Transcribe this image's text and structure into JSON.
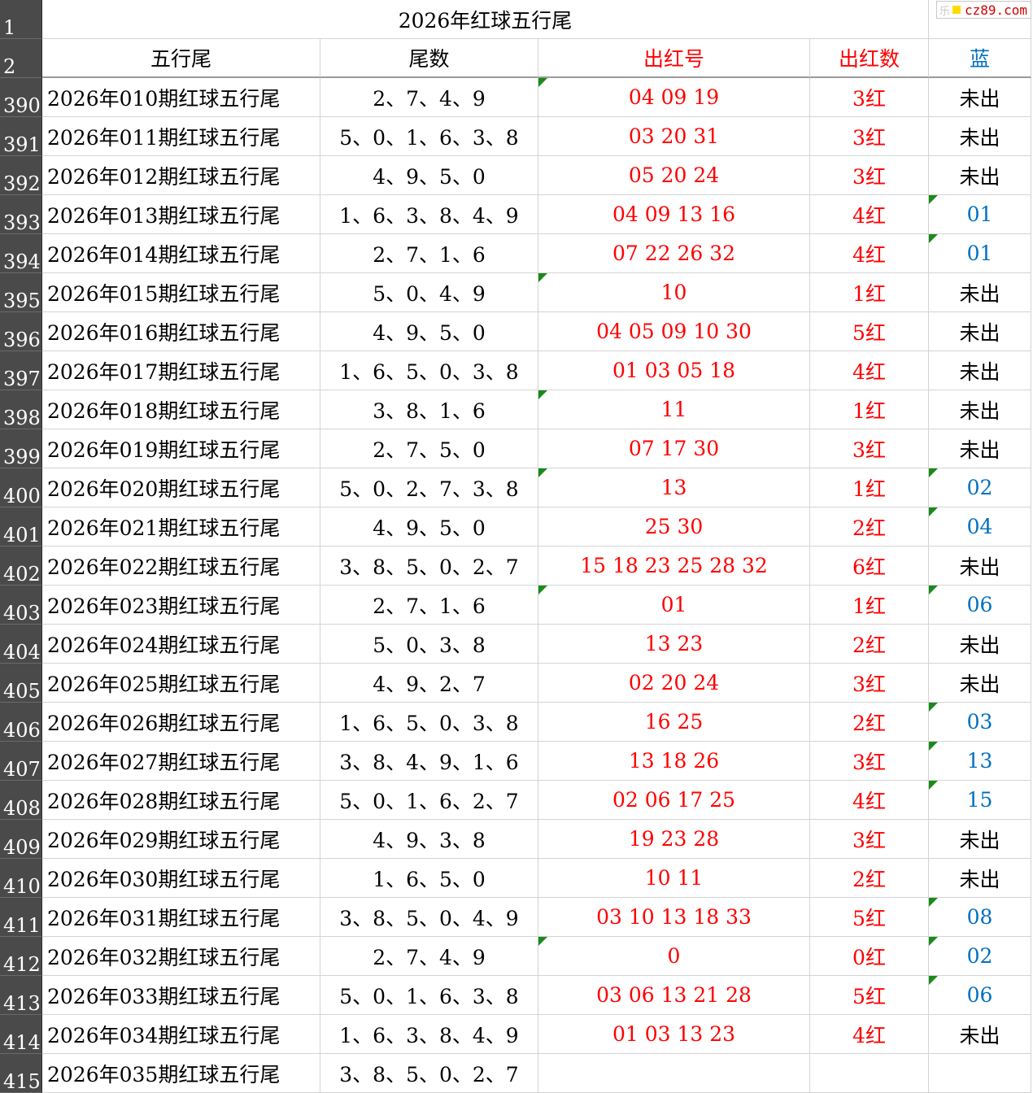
{
  "title": "2026年红球五行尾",
  "watermark": "cz89.com",
  "watermark_faint": "乐",
  "row_numbers": {
    "title": "1",
    "header": "2"
  },
  "headers": {
    "col1": "五行尾",
    "col2": "尾数",
    "col3": "出红号",
    "col4": "出红数",
    "col5": "蓝"
  },
  "colors": {
    "red": "#ff0000",
    "blue": "#0070c0",
    "row_header_bg": "#4a4a4a",
    "marker": "#1a8a1a"
  },
  "rows": [
    {
      "n": "390",
      "period": "2026年010期红球五行尾",
      "tails": "2、7、4、9",
      "reds": "04  09  19",
      "count": "3红",
      "blue": "未出"
    },
    {
      "n": "391",
      "period": "2026年011期红球五行尾",
      "tails": "5、0、1、6、3、8",
      "reds": "03  20  31",
      "count": "3红",
      "blue": "未出"
    },
    {
      "n": "392",
      "period": "2026年012期红球五行尾",
      "tails": "4、9、5、0",
      "reds": "05  20  24",
      "count": "3红",
      "blue": "未出"
    },
    {
      "n": "393",
      "period": "2026年013期红球五行尾",
      "tails": "1、6、3、8、4、9",
      "reds": "04  09  13  16",
      "count": "4红",
      "blue": "01"
    },
    {
      "n": "394",
      "period": "2026年014期红球五行尾",
      "tails": "2、7、1、6",
      "reds": "07  22  26  32",
      "count": "4红",
      "blue": "01"
    },
    {
      "n": "395",
      "period": "2026年015期红球五行尾",
      "tails": "5、0、4、9",
      "reds": "10",
      "count": "1红",
      "blue": "未出"
    },
    {
      "n": "396",
      "period": "2026年016期红球五行尾",
      "tails": "4、9、5、0",
      "reds": "04  05  09  10  30",
      "count": "5红",
      "blue": "未出"
    },
    {
      "n": "397",
      "period": "2026年017期红球五行尾",
      "tails": "1、6、5、0、3、8",
      "reds": "01  03  05  18",
      "count": "4红",
      "blue": "未出"
    },
    {
      "n": "398",
      "period": "2026年018期红球五行尾",
      "tails": "3、8、1、6",
      "reds": "11",
      "count": "1红",
      "blue": "未出"
    },
    {
      "n": "399",
      "period": "2026年019期红球五行尾",
      "tails": "2、7、5、0",
      "reds": "07  17  30",
      "count": "3红",
      "blue": "未出"
    },
    {
      "n": "400",
      "period": "2026年020期红球五行尾",
      "tails": "5、0、2、7、3、8",
      "reds": "13",
      "count": "1红",
      "blue": "02"
    },
    {
      "n": "401",
      "period": "2026年021期红球五行尾",
      "tails": "4、9、5、0",
      "reds": "25  30",
      "count": "2红",
      "blue": "04"
    },
    {
      "n": "402",
      "period": "2026年022期红球五行尾",
      "tails": "3、8、5、0、2、7",
      "reds": "15  18  23  25  28  32",
      "count": "6红",
      "blue": "未出"
    },
    {
      "n": "403",
      "period": "2026年023期红球五行尾",
      "tails": "2、7、1、6",
      "reds": "01",
      "count": "1红",
      "blue": "06"
    },
    {
      "n": "404",
      "period": "2026年024期红球五行尾",
      "tails": "5、0、3、8",
      "reds": "13  23",
      "count": "2红",
      "blue": "未出"
    },
    {
      "n": "405",
      "period": "2026年025期红球五行尾",
      "tails": "4、9、2、7",
      "reds": "02  20  24",
      "count": "3红",
      "blue": "未出"
    },
    {
      "n": "406",
      "period": "2026年026期红球五行尾",
      "tails": "1、6、5、0、3、8",
      "reds": "16  25",
      "count": "2红",
      "blue": "03"
    },
    {
      "n": "407",
      "period": "2026年027期红球五行尾",
      "tails": "3、8、4、9、1、6",
      "reds": "13  18  26",
      "count": "3红",
      "blue": "13"
    },
    {
      "n": "408",
      "period": "2026年028期红球五行尾",
      "tails": "5、0、1、6、2、7",
      "reds": "02  06  17  25",
      "count": "4红",
      "blue": "15"
    },
    {
      "n": "409",
      "period": "2026年029期红球五行尾",
      "tails": "4、9、3、8",
      "reds": "19  23  28",
      "count": "3红",
      "blue": "未出"
    },
    {
      "n": "410",
      "period": "2026年030期红球五行尾",
      "tails": "1、6、5、0",
      "reds": "10  11",
      "count": "2红",
      "blue": "未出"
    },
    {
      "n": "411",
      "period": "2026年031期红球五行尾",
      "tails": "3、8、5、0、4、9",
      "reds": "03  10  13  18  33",
      "count": "5红",
      "blue": "08"
    },
    {
      "n": "412",
      "period": "2026年032期红球五行尾",
      "tails": "2、7、4、9",
      "reds": "0",
      "count": "0红",
      "blue": "02"
    },
    {
      "n": "413",
      "period": "2026年033期红球五行尾",
      "tails": "5、0、1、6、3、8",
      "reds": "03  06  13  21  28",
      "count": "5红",
      "blue": "06"
    },
    {
      "n": "414",
      "period": "2026年034期红球五行尾",
      "tails": "1、6、3、8、4、9",
      "reds": "01  03  13  23",
      "count": "4红",
      "blue": "未出"
    },
    {
      "n": "415",
      "period": "2026年035期红球五行尾",
      "tails": "3、8、5、0、2、7",
      "reds": "",
      "count": "",
      "blue": ""
    }
  ]
}
